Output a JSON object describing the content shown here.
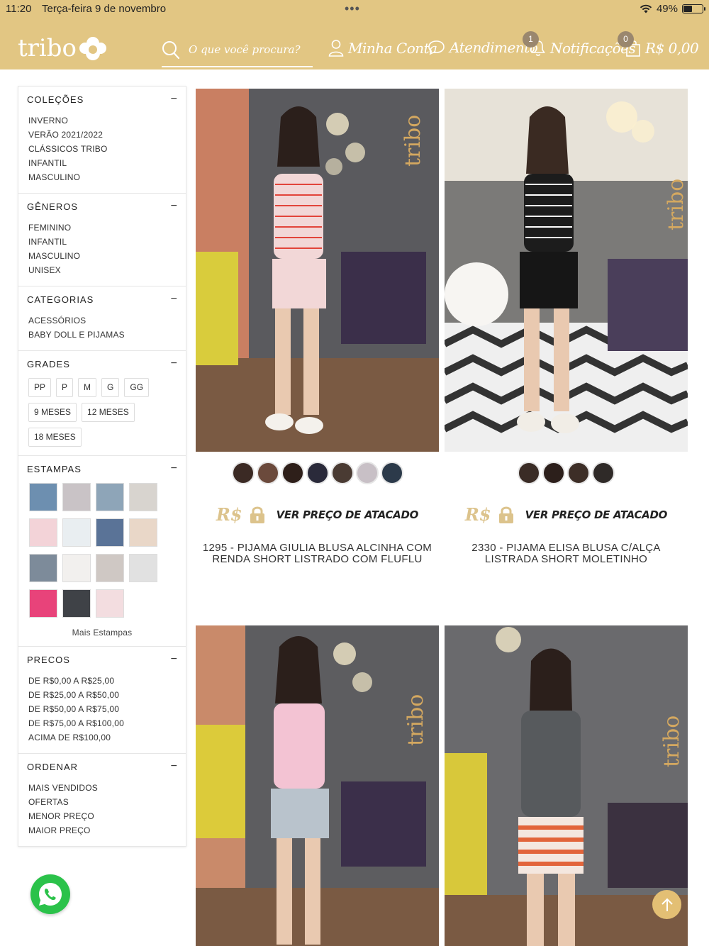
{
  "status_bar": {
    "time": "11:20",
    "date": "Terça-feira 9 de novembro",
    "dots": "•••",
    "battery_pct": "49%",
    "battery_level": 0.49
  },
  "header": {
    "logo_text": "tribo",
    "search_placeholder": "O que você procura?",
    "account_label": "Minha Conta",
    "support_label": "Atendimento",
    "notifications_label": "Notificações",
    "notifications_count": "1",
    "cart_count": "0",
    "cart_total": "R$ 0,00",
    "bg_color": "#e2c683"
  },
  "sidebar": {
    "toggle_symbol": "−",
    "colecoes": {
      "title": "COLEÇÕES",
      "items": [
        "INVERNO",
        "VERÃO 2021/2022",
        "CLÁSSICOS TRIBO",
        "INFANTIL",
        "MASCULINO"
      ]
    },
    "generos": {
      "title": "GÊNEROS",
      "items": [
        "FEMININO",
        "INFANTIL",
        "MASCULINO",
        "UNISEX"
      ]
    },
    "categorias": {
      "title": "CATEGORIAS",
      "items": [
        "ACESSÓRIOS",
        "BABY DOLL E PIJAMAS"
      ]
    },
    "grades": {
      "title": "GRADES",
      "sizes": [
        "PP",
        "P",
        "M",
        "G",
        "GG",
        "9 MESES",
        "12 MESES",
        "18 MESES"
      ]
    },
    "estampas": {
      "title": "ESTAMPAS",
      "more_label": "Mais Estampas",
      "swatch_colors": [
        "#6d8fb0",
        "#c9c3c6",
        "#8ea5b8",
        "#d8d4cf",
        "#f3d3d8",
        "#e9eef1",
        "#5a7397",
        "#e9d7c8",
        "#7d8b9a",
        "#f2f0ee",
        "#cfc8c4",
        "#e1e1e1",
        "#e8437a",
        "#3f4247",
        "#f3dde0"
      ]
    },
    "precos": {
      "title": "PRECOS",
      "items": [
        "DE R$0,00 A R$25,00",
        "DE R$25,00 A R$50,00",
        "DE R$50,00 A R$75,00",
        "DE R$75,00 A R$100,00",
        "ACIMA DE R$100,00"
      ]
    },
    "ordenar": {
      "title": "ORDENAR",
      "items": [
        "MAIS VENDIDOS",
        "OFERTAS",
        "MENOR PREÇO",
        "MAIOR PREÇO"
      ]
    }
  },
  "products": [
    {
      "name_line1": "1295 - PIJAMA GIULIA BLUSA ALCINHA COM",
      "name_line2": "RENDA SHORT LISTRADO COM FLUFLU",
      "price_symbol": "R$",
      "price_cta": "VER PREÇO DE ATACADO",
      "color_dots": [
        "#3b2a24",
        "#6b4a3c",
        "#2e1f1a",
        "#2a2a3a",
        "#4a3b33",
        "#c8c0c6",
        "#2c3a4a"
      ]
    },
    {
      "name_line1": "2330 - PIJAMA ELISA BLUSA C/ALÇA",
      "name_line2": "LISTRADA SHORT MOLETINHO",
      "price_symbol": "R$",
      "price_cta": "VER PREÇO DE ATACADO",
      "color_dots": [
        "#3a2c26",
        "#2c1f1b",
        "#3d2e27",
        "#2f2a28"
      ]
    },
    {
      "name_line1": "",
      "name_line2": ""
    },
    {
      "name_line1": "",
      "name_line2": ""
    }
  ],
  "colors": {
    "brand_gold": "#e2c683",
    "price_gold": "#dcc38c",
    "whatsapp_green": "#2bc24a"
  }
}
